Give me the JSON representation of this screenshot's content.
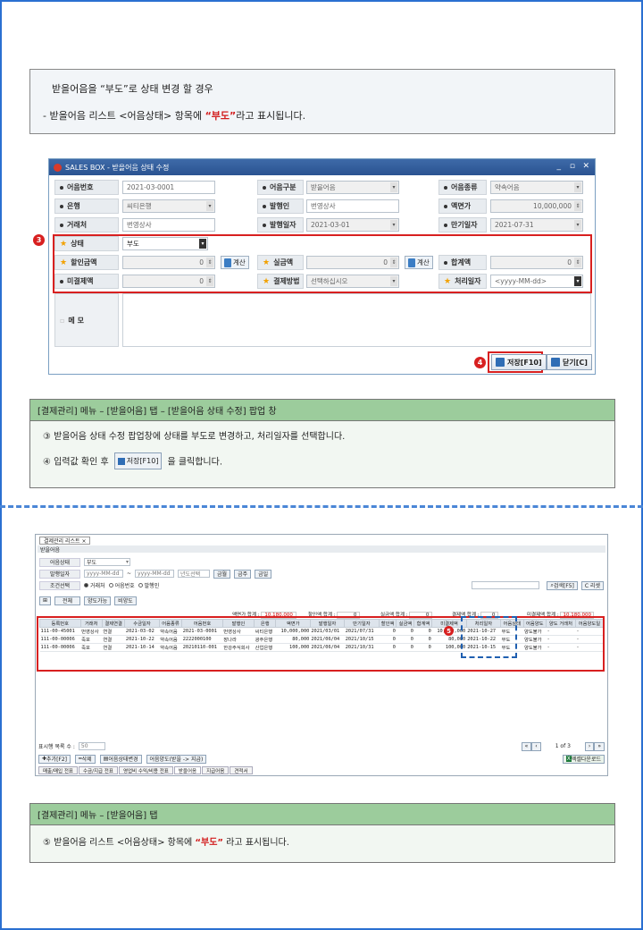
{
  "note": {
    "line1": "받을어음을 “부도”로 상태 변경 할 경우",
    "line2_pre": "- 받을어음 리스트 <어음상태> 항목에 ",
    "line2_em": "“부도”",
    "line2_post": "라고 표시됩니다."
  },
  "popup": {
    "title": "SALES BOX - 받을어음 상태 수정",
    "fields": {
      "bill_no_label": "어음번호",
      "bill_no": "2021-03-0001",
      "bill_type_label": "어음구분",
      "bill_type": "받을어음",
      "bill_kind_label": "어음종류",
      "bill_kind": "약속어음",
      "bank_label": "은행",
      "bank": "씨티은행",
      "issuer_label": "발행인",
      "issuer": "번영상사",
      "face_label": "액면가",
      "face": "10,000,000",
      "client_label": "거래처",
      "client": "번영상사",
      "issue_date_label": "발행일자",
      "issue_date": "2021-03-01",
      "due_date_label": "만기일자",
      "due_date": "2021-07-31",
      "status_label": "상태",
      "status": "부도",
      "discount_label": "할인금액",
      "discount": "0",
      "actual_label": "실금액",
      "actual": "0",
      "total_label": "합계액",
      "total": "0",
      "unsettled_label": "미결제액",
      "unsettled": "0",
      "method_label": "결제방법",
      "method": "선택하십시오",
      "proc_date_label": "처리일자",
      "proc_date": "<yyyy-MM-dd>",
      "memo_label": "메 모",
      "calc1": "계산",
      "calc2": "계산"
    },
    "marker3": "3",
    "marker4": "4",
    "save": "저장[F10]",
    "close": "닫기[C]"
  },
  "cap1": {
    "header": "[결제관리] 메뉴 – [받을어음] 탭 – [받을어음 상태 수정] 팝업 창",
    "p1": "③  받을어음 상태 수정 팝업창에 상태를 부도로 변경하고, 처리일자를 선택합니다.",
    "p2_pre": "④  입력값 확인 후",
    "p2_btn": "저장[F10]",
    "p2_post": "을  클릭합니다."
  },
  "list": {
    "tab": "결제관리 리스트 ×",
    "subtitle": "받을어음",
    "status_label": "어음상태",
    "status_value": "부도",
    "date_label": "발행일자",
    "date_from": "yyyy-MM-dd",
    "tilde": "~",
    "date_to": "yyyy-MM-dd",
    "year_select": "년도선택",
    "btn_prev": "금월",
    "btn_mid": "금주",
    "btn_next": "금일",
    "cond_label": "조건선택",
    "r1": "거래처",
    "r2": "어음번호",
    "r3": "발행인",
    "search": "검색[F5]",
    "reset": "C 리셋",
    "act1": "전체",
    "act2": "양도가능",
    "act3": "비양도",
    "sum1_label": "액면가 합계 :",
    "sum1": "10,180,000",
    "sum2_label": "할인액 합계 :",
    "sum2": "0",
    "sum3_label": "실금액 합계 :",
    "sum3": "0",
    "sum4_label": "결제액 합계 :",
    "sum4": "0",
    "sum5_label": "미결제액 합계 :",
    "sum5": "10,180,000",
    "headers": [
      "등록번호",
      "거래처",
      "결제연결",
      "수금일자",
      "어음종류",
      "어음번호",
      "발행인",
      "은행",
      "액면가",
      "발행일자",
      "만기일자",
      "할인액",
      "실금액",
      "합계액",
      "미결제액",
      "처리일자",
      "어음상태",
      "어음양도",
      "양도 거래처",
      "어음양도일"
    ],
    "rows": [
      [
        "111-00-45001",
        "번영상사",
        "연결",
        "2021-03-02",
        "약속어음",
        "2021-03-0001",
        "번영상사",
        "씨티은행",
        "10,000,000",
        "2021/03/01",
        "2021/07/31",
        "0",
        "0",
        "0",
        "10,000,000",
        "2021-10-27",
        "부도",
        "양도불가",
        "-",
        "-"
      ],
      [
        "111-00-00006",
        "죽포",
        "연결",
        "2021-10-22",
        "약속어음",
        "2222000100",
        "장나라",
        "광주은행",
        "80,000",
        "2021/06/04",
        "2021/10/15",
        "0",
        "0",
        "0",
        "80,000",
        "2021-10-22",
        "부도",
        "양도불가",
        "-",
        "-"
      ],
      [
        "111-00-00006",
        "죽포",
        "연결",
        "2021-10-14",
        "약속어음",
        "20210110-001",
        "한강주식회사",
        "산업은행",
        "100,000",
        "2021/06/04",
        "2021/10/31",
        "0",
        "0",
        "0",
        "100,000",
        "2021-10-15",
        "부도",
        "양도불가",
        "-",
        "-"
      ]
    ],
    "marker5": "5",
    "perpage_label": "표시행 목록 수 :",
    "perpage": "50",
    "page": "1 of 3",
    "add": "추가[F2]",
    "del": "삭제",
    "chg": "어음상태변경",
    "transfer": "어음양도(받을 -> 지급)",
    "excel": "엑셀다운로드",
    "btabs": [
      "매출/매입 전표",
      "수금/지급 전표",
      "영업비 수익/비용 전표",
      "받을어음",
      "지급어음",
      "견적서"
    ]
  },
  "cap2": {
    "header": "[결제관리] 메뉴 – [받을어음] 탭",
    "p_pre": "⑤  받을어음 리스트 <어음상태> 항목에 ",
    "p_em": "“부도”",
    "p_post": " 라고 표시됩니다."
  }
}
